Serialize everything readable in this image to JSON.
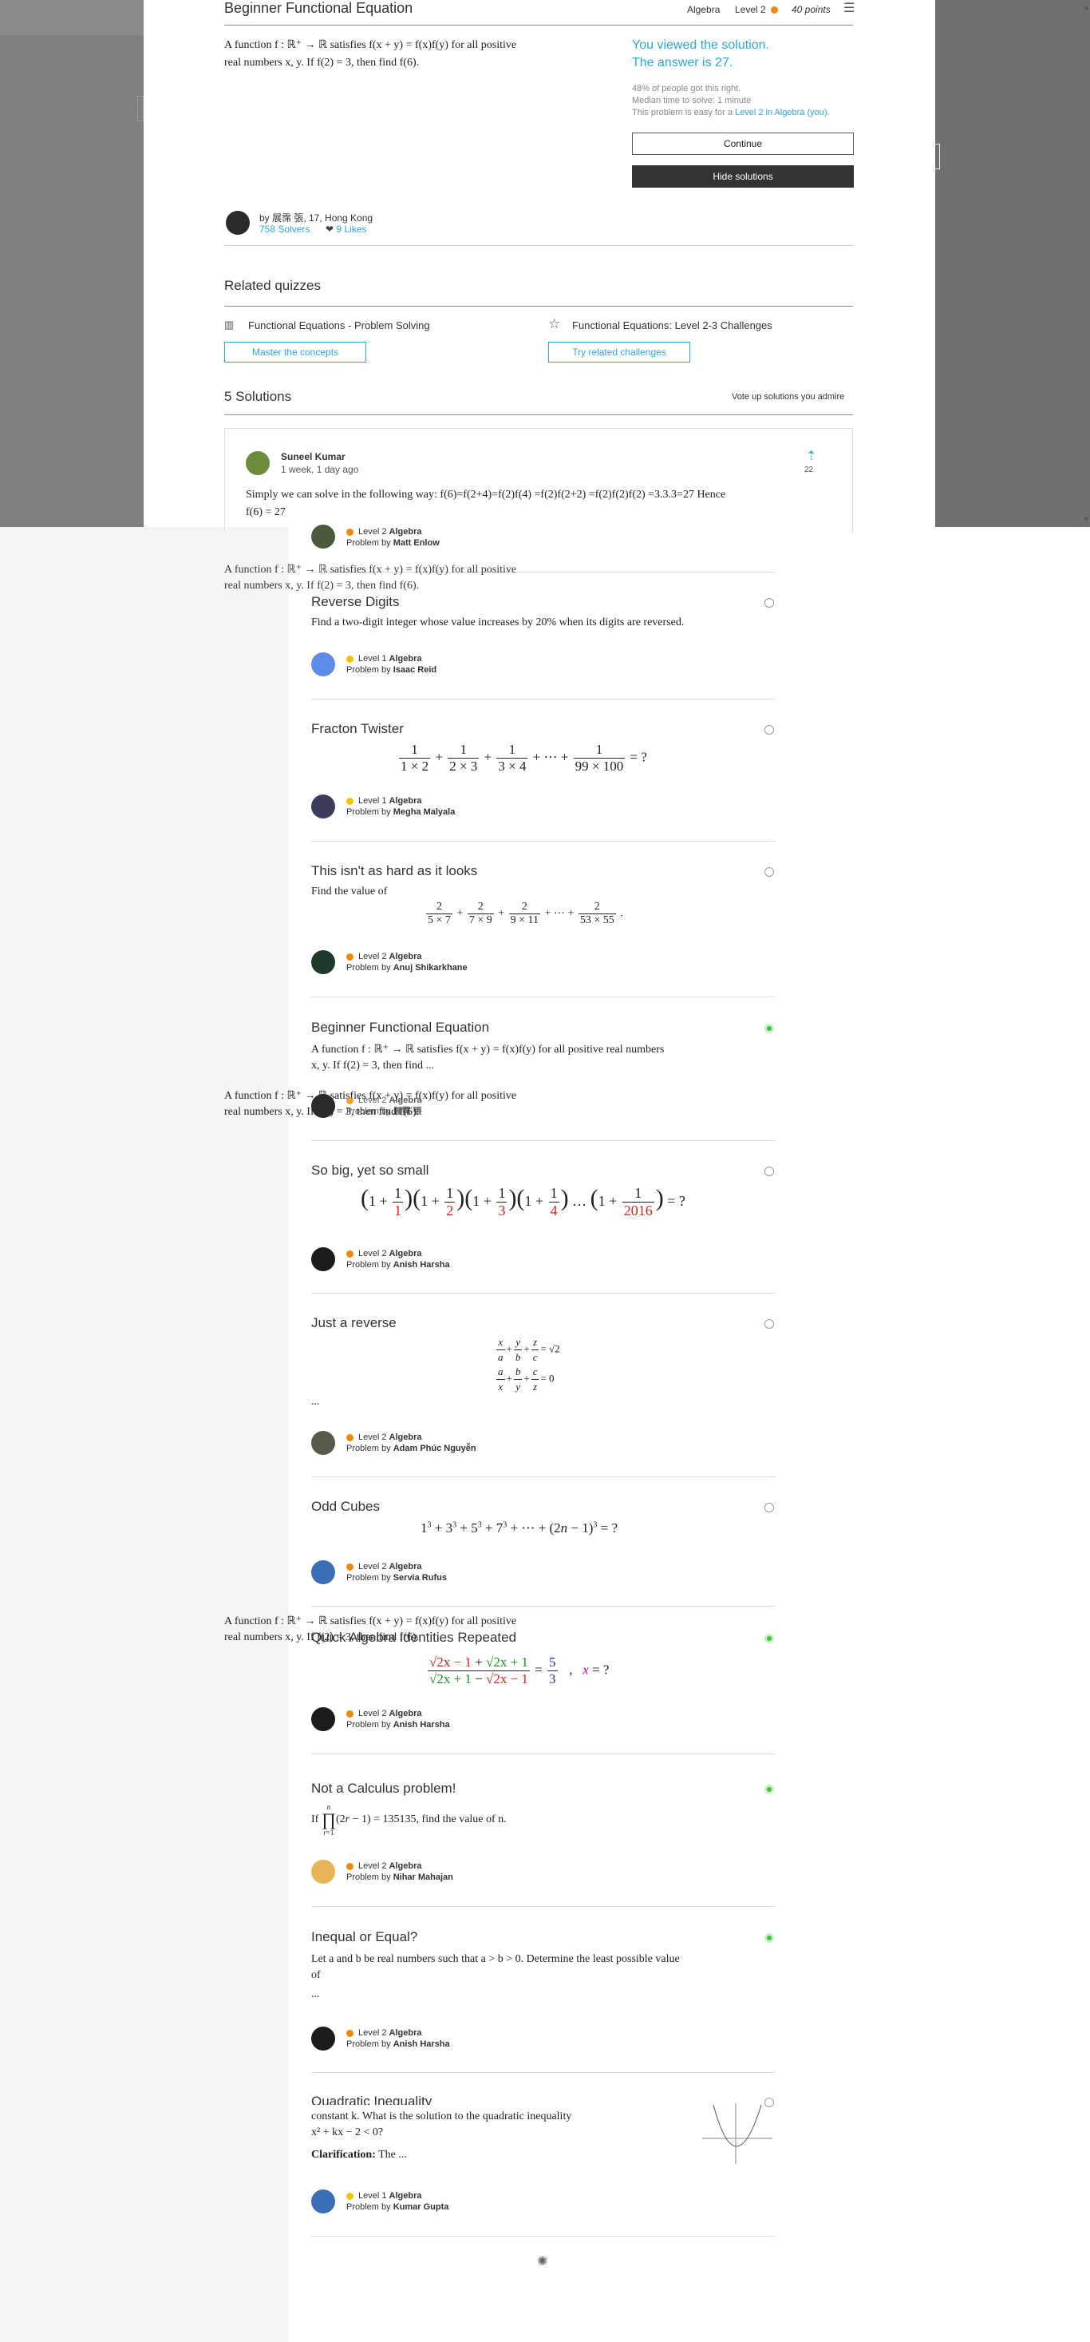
{
  "modal": {
    "title": "Beginner Functional Equation",
    "topic": "Algebra",
    "level": "Level 2",
    "points": "40 points",
    "problem_line1": "A function f : ℝ⁺ → ℝ satisfies f(x + y) = f(x)f(y) for all positive",
    "problem_line2": "real numbers x, y. If f(2) = 3, then find f(6).",
    "viewed": "You viewed the solution.",
    "answer": "The answer is 27.",
    "stat1": "48% of people got this right.",
    "stat2": "Median time to solve: 1 minute",
    "stat3_prefix": "This problem is easy for a ",
    "stat3_link": "Level 2 in Algebra (you).",
    "continue_label": "Continue",
    "hide_label": "Hide solutions",
    "author": "by 展霈 張, 17, Hong Kong",
    "solvers": "758 Solvers",
    "likes": "9 Likes",
    "related_heading": "Related quizzes",
    "quiz1_title": "Functional Equations - Problem Solving",
    "quiz1_button": "Master the concepts",
    "quiz2_title": "Functional Equations: Level 2-3 Challenges",
    "quiz2_button": "Try related challenges",
    "solutions_heading": "5 Solutions",
    "vote_text": "Vote up solutions you admire",
    "solution_author": "Suneel Kumar",
    "solution_time": "1 week, 1 day ago",
    "solution_votes": "22",
    "solution_text1": "Simply we can solve in the following way: f(6)=f(2+4)=f(2)f(4) =f(2)f(2+2) =f(2)f(2)f(2) =3.3.3=27 Hence",
    "solution_text2": "f(6) = 27"
  },
  "feed": {
    "first_meta_level": "Level 2",
    "first_meta_topic": "Algebra",
    "first_meta_by": "Problem by",
    "first_meta_author": "Matt Enlow",
    "items": [
      {
        "title": "Reverse Digits",
        "text": "Find a two-digit integer whose value increases by 20% when its digits are reversed.",
        "level": "Level 1",
        "topic": "Algebra",
        "author": "Isaac Reid"
      },
      {
        "title": "Fracton Twister",
        "level": "Level 1",
        "topic": "Algebra",
        "author": "Megha Malyala"
      },
      {
        "title": "This isn't as hard as it looks",
        "text": "Find the value of",
        "level": "Level 2",
        "topic": "Algebra",
        "author": "Anuj Shikarkhane"
      },
      {
        "title": "Beginner Functional Equation",
        "text1": "A function f : ℝ⁺ → ℝ satisfies f(x + y) = f(x)f(y) for all positive real numbers",
        "text2": "x, y. If f(2) = 3, then find ...",
        "level": "Level 2",
        "topic": "Algebra",
        "author": "展霈 張"
      },
      {
        "title": "So big, yet so small",
        "level": "Level 2",
        "topic": "Algebra",
        "author": "Anish Harsha"
      },
      {
        "title": "Just a reverse",
        "ellipsis": "...",
        "level": "Level 2",
        "topic": "Algebra",
        "author": "Adam Phúc Nguyễn"
      },
      {
        "title": "Odd Cubes",
        "level": "Level 2",
        "topic": "Algebra",
        "author": "Servia Rufus"
      },
      {
        "title": "Quick Algebra Identities Repeated",
        "level": "Level 2",
        "topic": "Algebra",
        "author": "Anish Harsha"
      },
      {
        "title": "Not a Calculus problem!",
        "text": "= 135135, find the value of n.",
        "level": "Level 2",
        "topic": "Algebra",
        "author": "Nihar Mahajan"
      },
      {
        "title": "Inequal or Equal?",
        "text1": "Let a and b be real numbers such that a > b > 0. Determine the least possible value",
        "text2": "of",
        "ellipsis": "...",
        "level": "Level 2",
        "topic": "Algebra",
        "author": "Anish Harsha"
      },
      {
        "title": "Quadratic Inequality",
        "text1": "constant k. What is the solution to the quadratic inequality",
        "text2": "x² + kx − 2 < 0?",
        "clar_label": "Clarification:",
        "clar_text": "The ...",
        "level": "Level 1",
        "topic": "Algebra",
        "author": "Kumar Gupta"
      }
    ]
  },
  "ghost": {
    "line1": "A function f : ℝ⁺ → ℝ satisfies f(x + y) = f(x)f(y) for all positive",
    "line2": "real numbers x, y. If f(2) = 3, then find f(6)."
  }
}
